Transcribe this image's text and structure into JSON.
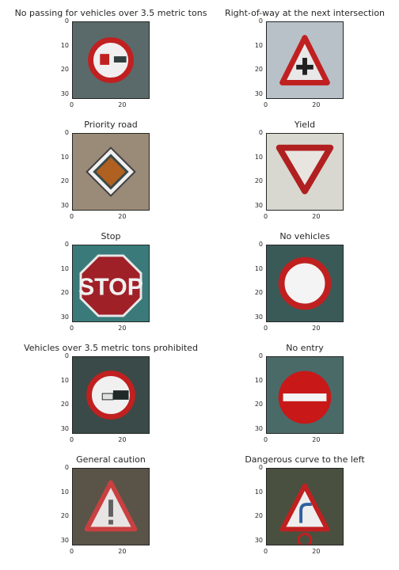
{
  "chart_data": {
    "type": "image-grid",
    "title": "",
    "axes": {
      "x_ticks": [
        "0",
        "20"
      ],
      "y_ticks": [
        "0",
        "10",
        "20",
        "30"
      ],
      "range": [
        0,
        32
      ],
      "grid": false
    },
    "panels": [
      {
        "title": "No passing for vehicles over 3.5 metric tons",
        "sign_icon": "no-passing-trucks-icon",
        "bg": "#5a6a6a"
      },
      {
        "title": "Right-of-way at the next intersection",
        "sign_icon": "right-of-way-icon",
        "bg": "#b8c0c8"
      },
      {
        "title": "Priority road",
        "sign_icon": "priority-road-icon",
        "bg": "#9a8a78"
      },
      {
        "title": "Yield",
        "sign_icon": "yield-icon",
        "bg": "#d8d8d0"
      },
      {
        "title": "Stop",
        "sign_icon": "stop-icon",
        "bg": "#3a7a7a"
      },
      {
        "title": "No vehicles",
        "sign_icon": "no-vehicles-icon",
        "bg": "#3a5a58"
      },
      {
        "title": "Vehicles over 3.5 metric tons prohibited",
        "sign_icon": "trucks-prohibited-icon",
        "bg": "#3a4a48"
      },
      {
        "title": "No entry",
        "sign_icon": "no-entry-icon",
        "bg": "#4a6a68"
      },
      {
        "title": "General caution",
        "sign_icon": "general-caution-icon",
        "bg": "#5a5448"
      },
      {
        "title": "Dangerous curve to the left",
        "sign_icon": "dangerous-curve-left-icon",
        "bg": "#4a5040"
      }
    ]
  }
}
